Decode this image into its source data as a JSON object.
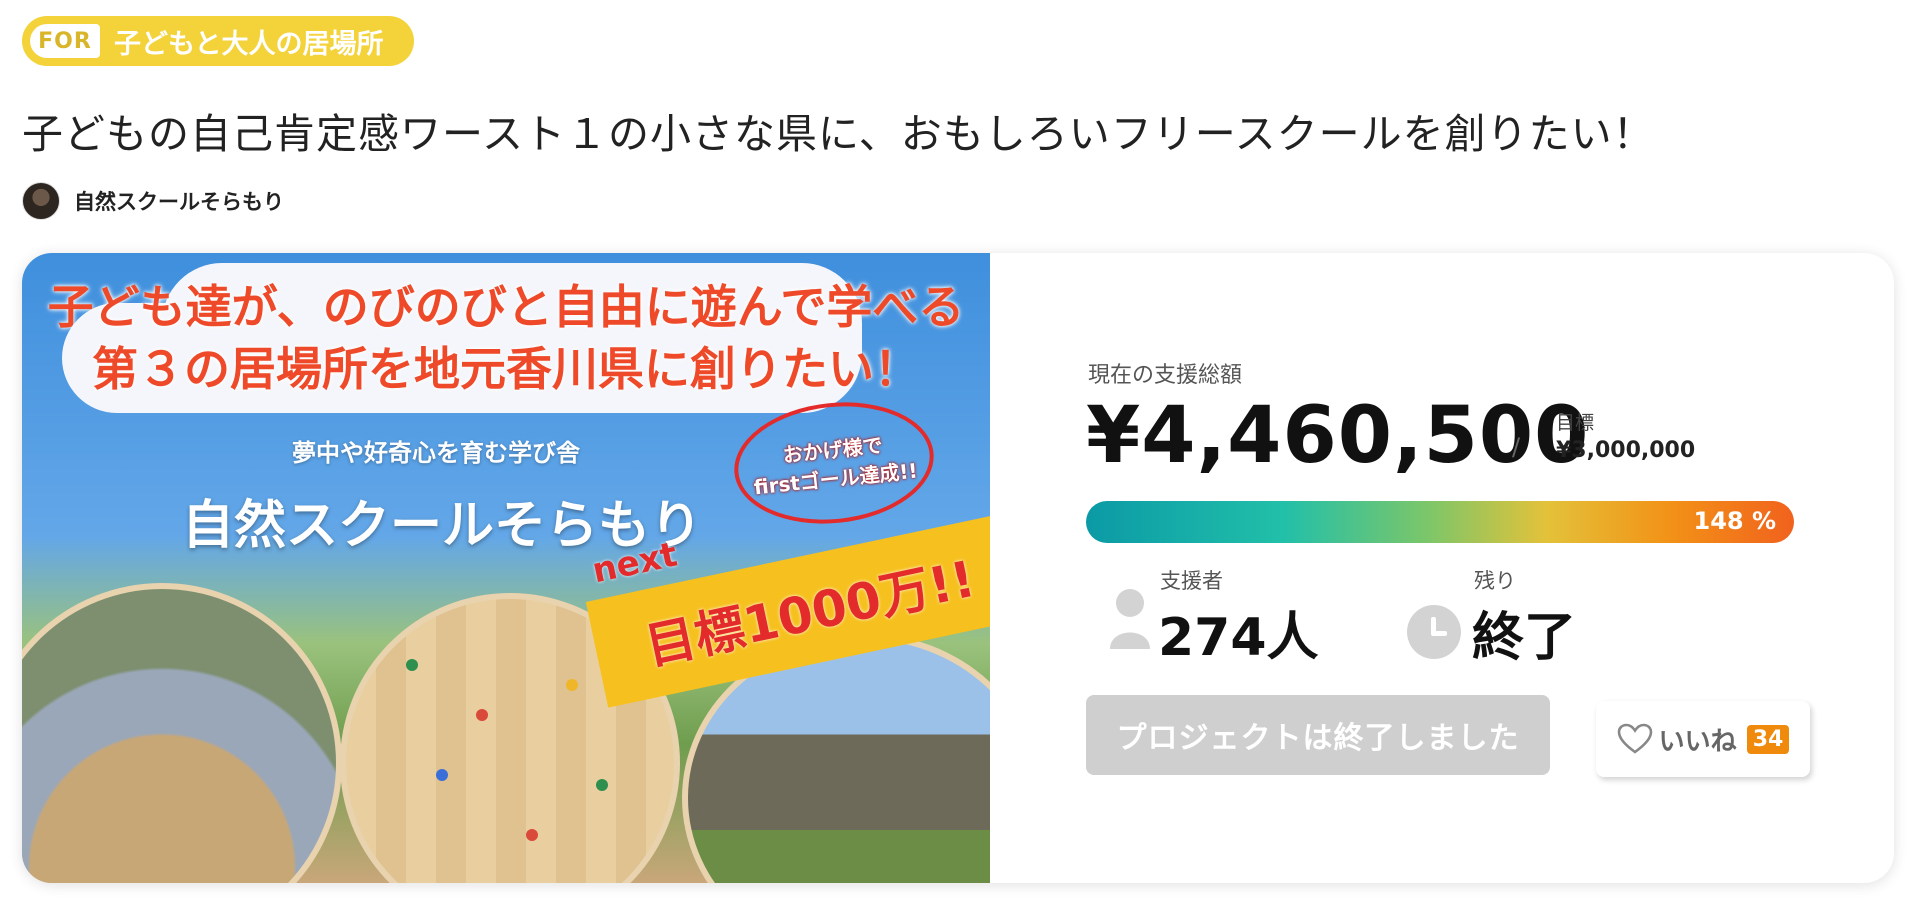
{
  "category": {
    "for_label": "FOR",
    "text": "子どもと大人の居場所"
  },
  "project": {
    "title": "子どもの自己肯定感ワースト１の小さな県に、おもしろいフリースクールを創りたい！",
    "owner_name": "自然スクールそらもり"
  },
  "hero": {
    "line1": "子ども達が、のびのびと自由に遊んで学べる",
    "line2": "第３の居場所を地元香川県に創りたい！",
    "sub": "夢中や好奇心を育む学び舎",
    "school": "自然スクールそらもり",
    "note_line1": "おかげ様で",
    "note_line2": "firstゴール達成!!",
    "next": "next",
    "goal": "目標1000万!!"
  },
  "funding": {
    "total_label": "現在の支援総額",
    "amount": "¥4,460,500",
    "slash": "/",
    "goal_label": "目標",
    "goal_value": "¥3,000,000",
    "percent_text": "148 %",
    "progress_fraction": 1.0
  },
  "stats": {
    "backers_label": "支援者",
    "backers_value": "274人",
    "remaining_label": "残り",
    "remaining_value": "終了"
  },
  "actions": {
    "ended_button": "プロジェクトは終了しました",
    "like_label": "いいね",
    "like_count": "34"
  },
  "colors": {
    "badge_yellow": "#f3d23a",
    "like_orange": "#f08a0d",
    "button_disabled": "#cfcfcf"
  }
}
